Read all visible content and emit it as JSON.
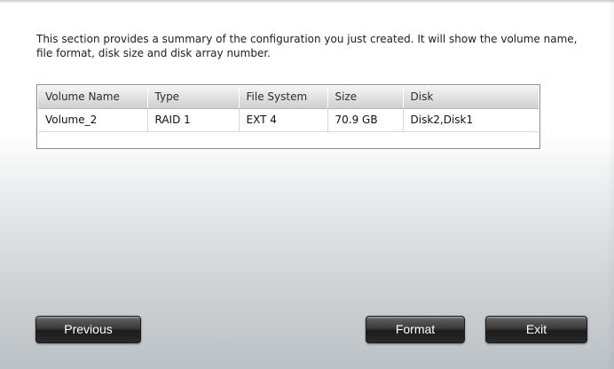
{
  "description": "This section provides a summary of the configuration you just created. It will show the volume name, file format, disk size and disk array number.",
  "table": {
    "headers": [
      "Volume Name",
      "Type",
      "File System",
      "Size",
      "Disk"
    ],
    "rows": [
      [
        "Volume_2",
        "RAID 1",
        "EXT 4",
        "70.9 GB",
        "Disk2,Disk1"
      ]
    ]
  },
  "buttons": {
    "previous": "Previous",
    "format": "Format",
    "exit": "Exit"
  }
}
